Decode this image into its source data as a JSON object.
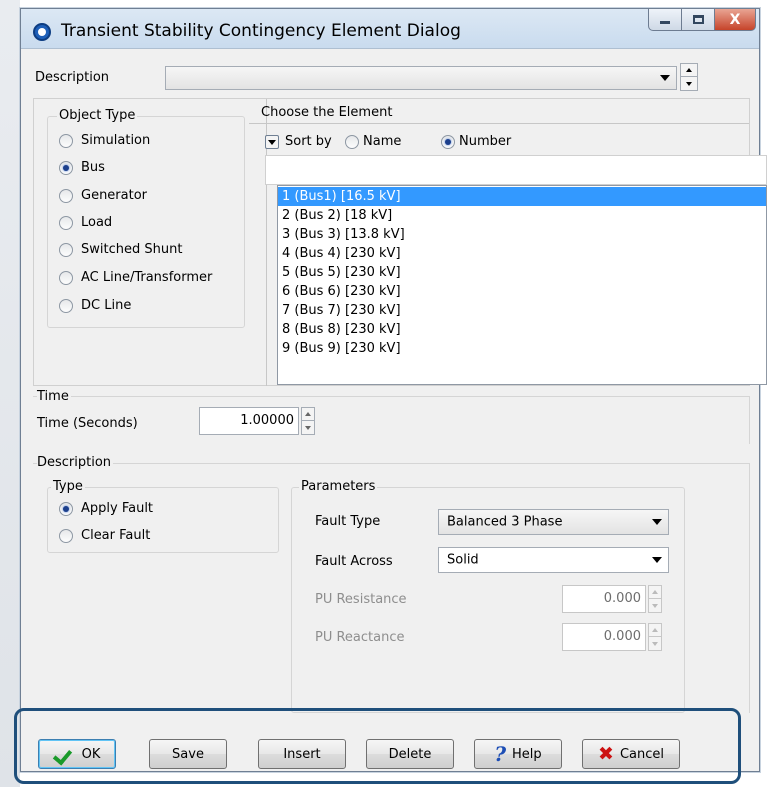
{
  "window": {
    "title": "Transient Stability Contingency Element Dialog",
    "close_glyph": "X"
  },
  "description_row": {
    "label": "Description",
    "value": ""
  },
  "object_type": {
    "label": "Object Type",
    "options": [
      "Simulation",
      "Bus",
      "Generator",
      "Load",
      "Switched Shunt",
      "AC Line/Transformer",
      "DC Line"
    ],
    "selected": "Bus"
  },
  "choose": {
    "title": "Choose the Element",
    "sort_by_label": "Sort by",
    "sort_name_label": "Name",
    "sort_number_label": "Number",
    "sort_selected": "Number",
    "filter_value": "",
    "items": [
      "1 (Bus1)  [16.5 kV]",
      "2 (Bus 2)  [18 kV]",
      "3 (Bus 3)  [13.8 kV]",
      "4 (Bus 4)  [230 kV]",
      "5 (Bus 5)  [230 kV]",
      "6 (Bus 6)  [230 kV]",
      "7 (Bus 7)  [230 kV]",
      "8 (Bus 8)  [230 kV]",
      "9 (Bus 9)  [230 kV]"
    ],
    "selected_index": 0
  },
  "time": {
    "group_label": "Time",
    "field_label": "Time (Seconds)",
    "value": "1.00000"
  },
  "desc_group": {
    "label": "Description",
    "type": {
      "label": "Type",
      "apply_fault": "Apply Fault",
      "clear_fault": "Clear Fault",
      "selected": "Apply Fault"
    },
    "params": {
      "label": "Parameters",
      "fault_type_label": "Fault Type",
      "fault_type_value": "Balanced 3 Phase",
      "fault_across_label": "Fault Across",
      "fault_across_value": "Solid",
      "pu_resistance_label": "PU Resistance",
      "pu_resistance_value": "0.000",
      "pu_reactance_label": "PU Reactance",
      "pu_reactance_value": "0.000"
    }
  },
  "buttons": {
    "ok": "OK",
    "save": "Save",
    "insert": "Insert",
    "delete": "Delete",
    "help": "Help",
    "cancel": "Cancel"
  },
  "colors": {
    "selection": "#3399ff",
    "highlight_box": "#1f4f7b"
  }
}
